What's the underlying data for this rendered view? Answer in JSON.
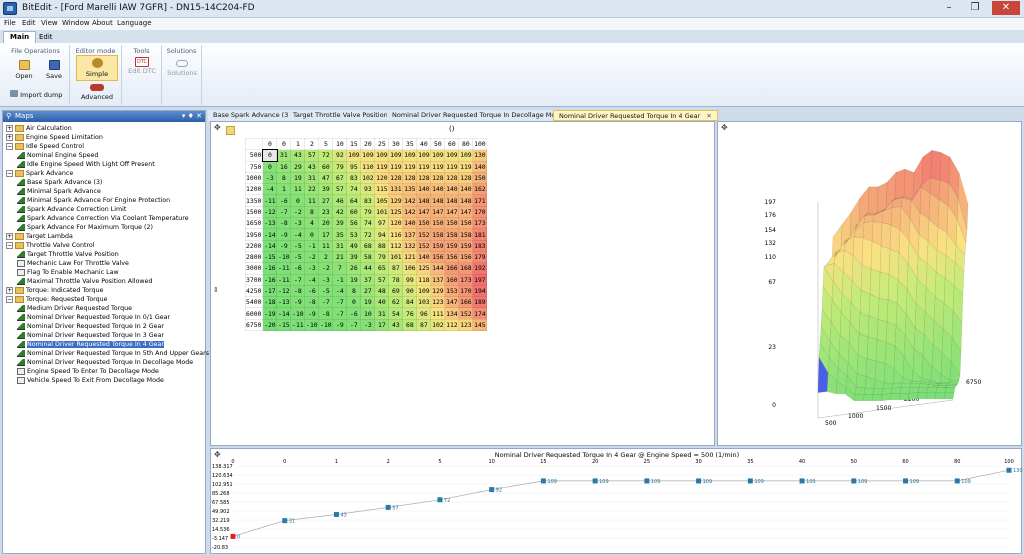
{
  "window": {
    "title": "BitEdit - [Ford Marelli IAW 7GFR] - DN15-14C204-FD",
    "min": "–",
    "restore": "❐",
    "close": "✕"
  },
  "menu": [
    "File",
    "Edit",
    "View",
    "Window",
    "About",
    "Language"
  ],
  "ribbon_tabs": [
    "Main",
    "Edit"
  ],
  "ribbon": {
    "groups": [
      "File Operations",
      "Editor mode",
      "Tools",
      "Solutions"
    ],
    "open": "Open",
    "save": "Save",
    "import": "Import dump",
    "simple": "Simple",
    "advanced": "Advanced",
    "edit_dtc": "Edit DTC",
    "dtc_badge": "DTC",
    "solutions": "Solutions"
  },
  "maps": {
    "title": "Maps",
    "pin": "▾ ♦ ✕",
    "tree": [
      {
        "level": 0,
        "type": "folder",
        "exp": "+",
        "label": "Air Calculation"
      },
      {
        "level": 0,
        "type": "folder",
        "exp": "+",
        "label": "Engine Speed Limitation"
      },
      {
        "level": 0,
        "type": "folder",
        "exp": "−",
        "label": "Idle Speed Control"
      },
      {
        "level": 1,
        "type": "map",
        "label": "Nominal Engine Speed"
      },
      {
        "level": 1,
        "type": "map",
        "label": "Idle Engine Speed With Light Off Present"
      },
      {
        "level": 0,
        "type": "folder",
        "exp": "−",
        "label": "Spark Advance"
      },
      {
        "level": 1,
        "type": "map",
        "label": "Base Spark Advance (3)"
      },
      {
        "level": 1,
        "type": "map",
        "label": "Minimal Spark Advance"
      },
      {
        "level": 1,
        "type": "map",
        "label": "Minimal Spark Advance For Engine Protection"
      },
      {
        "level": 1,
        "type": "map",
        "label": "Spark Advance Correction Limit"
      },
      {
        "level": 1,
        "type": "map",
        "label": "Spark Advance Correction Via Coolant Temperature"
      },
      {
        "level": 1,
        "type": "map",
        "label": "Spark Advance For Maximum Torque (2)"
      },
      {
        "level": 0,
        "type": "folder",
        "exp": "+",
        "label": "Target Lambda"
      },
      {
        "level": 0,
        "type": "folder",
        "exp": "−",
        "label": "Throttle Valve Control"
      },
      {
        "level": 1,
        "type": "map",
        "label": "Target Throttle Valve Position"
      },
      {
        "level": 1,
        "type": "flag",
        "label": "Mechanic Law For Throttle Valve"
      },
      {
        "level": 1,
        "type": "flag",
        "label": "Flag To Enable Mechanic Law"
      },
      {
        "level": 1,
        "type": "map",
        "label": "Maximal Throttle Valve Position Allowed"
      },
      {
        "level": 0,
        "type": "folder",
        "exp": "+",
        "label": "Torque: Indicated Torque"
      },
      {
        "level": 0,
        "type": "folder",
        "exp": "−",
        "label": "Torque: Requested Torque"
      },
      {
        "level": 1,
        "type": "map",
        "label": "Medium Driver Requested Torque"
      },
      {
        "level": 1,
        "type": "map",
        "label": "Nominal Driver Requested Torque In 0/1 Gear"
      },
      {
        "level": 1,
        "type": "map",
        "label": "Nominal Driver Requested Torque In 2 Gear"
      },
      {
        "level": 1,
        "type": "map",
        "label": "Nominal Driver Requested Torque In 3 Gear"
      },
      {
        "level": 1,
        "type": "map",
        "label": "Nominal Driver Requested Torque In 4 Gear",
        "selected": true
      },
      {
        "level": 1,
        "type": "map",
        "label": "Nominal Driver Requested Torque In 5th And Upper Gears"
      },
      {
        "level": 1,
        "type": "map",
        "label": "Nominal Driver Requested Torque In Decollage Mode"
      },
      {
        "level": 1,
        "type": "flag",
        "label": "Engine Speed To Enter To Decollage Mode"
      },
      {
        "level": 1,
        "type": "flag",
        "label": "Vehicle Speed To Exit From Decollage Mode"
      }
    ]
  },
  "doc_tabs": [
    {
      "label": "Base Spark Advance (3)"
    },
    {
      "label": "Target Throttle Valve Position"
    },
    {
      "label": "Nominal Driver Requested Torque In Decollage Mode"
    },
    {
      "label": "Nominal Driver Requested Torque In 4 Gear",
      "active": true,
      "close": "✕"
    }
  ],
  "grid": {
    "top_axis_label": "()",
    "columns": [
      "0",
      "0",
      "1",
      "2",
      "5",
      "10",
      "15",
      "20",
      "25",
      "30",
      "35",
      "40",
      "50",
      "60",
      "80",
      "100"
    ],
    "rows": [
      {
        "rpm": "500",
        "v": [
          0,
          31,
          43,
          57,
          72,
          92,
          109,
          109,
          109,
          109,
          109,
          109,
          109,
          109,
          109,
          130
        ]
      },
      {
        "rpm": "750",
        "v": [
          0,
          16,
          29,
          43,
          60,
          79,
          95,
          110,
          119,
          119,
          119,
          119,
          119,
          119,
          119,
          140
        ]
      },
      {
        "rpm": "1000",
        "v": [
          -3,
          8,
          19,
          31,
          47,
          67,
          83,
          102,
          120,
          128,
          128,
          128,
          128,
          128,
          128,
          150
        ]
      },
      {
        "rpm": "1200",
        "v": [
          -4,
          1,
          11,
          22,
          39,
          57,
          74,
          93,
          115,
          131,
          135,
          140,
          140,
          140,
          140,
          162
        ]
      },
      {
        "rpm": "1350",
        "v": [
          -11,
          -6,
          0,
          11,
          27,
          46,
          64,
          83,
          105,
          129,
          142,
          148,
          148,
          148,
          148,
          171
        ]
      },
      {
        "rpm": "1500",
        "v": [
          -12,
          -7,
          -2,
          8,
          23,
          42,
          60,
          79,
          101,
          125,
          142,
          147,
          147,
          147,
          147,
          170
        ]
      },
      {
        "rpm": "1650",
        "v": [
          -13,
          -8,
          -3,
          4,
          20,
          39,
          56,
          74,
          97,
          120,
          140,
          150,
          150,
          150,
          150,
          173
        ]
      },
      {
        "rpm": "1950",
        "v": [
          -14,
          -9,
          -4,
          0,
          17,
          35,
          53,
          72,
          94,
          116,
          137,
          152,
          158,
          158,
          158,
          181
        ]
      },
      {
        "rpm": "2200",
        "v": [
          -14,
          -9,
          -5,
          -1,
          11,
          31,
          49,
          68,
          88,
          112,
          132,
          152,
          159,
          159,
          159,
          183
        ]
      },
      {
        "rpm": "2800",
        "v": [
          -15,
          -10,
          -5,
          -2,
          2,
          21,
          39,
          58,
          79,
          101,
          121,
          140,
          156,
          156,
          156,
          179
        ]
      },
      {
        "rpm": "3000",
        "v": [
          -16,
          -11,
          -6,
          -3,
          -2,
          7,
          26,
          44,
          65,
          87,
          106,
          125,
          144,
          166,
          168,
          192
        ]
      },
      {
        "rpm": "3700",
        "v": [
          -16,
          -11,
          -7,
          -4,
          -3,
          -1,
          19,
          37,
          57,
          78,
          99,
          118,
          137,
          160,
          173,
          197
        ]
      },
      {
        "rpm": "4250",
        "v": [
          -17,
          -12,
          -8,
          -6,
          -5,
          -4,
          8,
          27,
          48,
          69,
          90,
          109,
          129,
          153,
          170,
          194
        ]
      },
      {
        "rpm": "5400",
        "v": [
          -18,
          -13,
          -9,
          -8,
          -7,
          -7,
          0,
          19,
          40,
          62,
          84,
          103,
          123,
          147,
          166,
          189
        ]
      },
      {
        "rpm": "6000",
        "v": [
          -19,
          -14,
          -10,
          -9,
          -8,
          -7,
          -6,
          10,
          31,
          54,
          76,
          96,
          111,
          134,
          152,
          174
        ]
      },
      {
        "rpm": "6750",
        "v": [
          -20,
          -15,
          -11,
          -10,
          -10,
          -9,
          -7,
          -3,
          17,
          43,
          68,
          87,
          102,
          112,
          123,
          145
        ]
      }
    ]
  },
  "graph3d": {
    "z_ticks": [
      "197",
      "176",
      "154",
      "132",
      "110",
      "67",
      "23",
      "0"
    ],
    "x_ticks": [
      "500",
      "1000",
      "1500",
      "2200",
      "3700",
      "6750"
    ]
  },
  "bottom": {
    "title": "Nominal Driver Requested Torque In 4 Gear @ Engine Speed = 500 (1/min)",
    "y_ticks": [
      "138.317",
      "120.634",
      "102.951",
      "85.268",
      "67.585",
      "49.902",
      "32.219",
      "14.536",
      "-3.147",
      "-20.83"
    ],
    "x_ticks": [
      "0",
      "0",
      "1",
      "2",
      "5",
      "10",
      "15",
      "20",
      "25",
      "30",
      "35",
      "40",
      "50",
      "60",
      "80",
      "100"
    ],
    "values": [
      0,
      31,
      43,
      57,
      72,
      92,
      109,
      109,
      109,
      109,
      109,
      109,
      109,
      109,
      109,
      130
    ]
  }
}
